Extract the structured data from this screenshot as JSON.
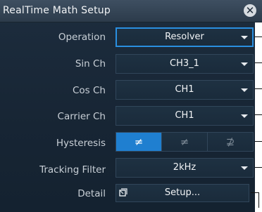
{
  "title": "RealTime Math Setup",
  "close_icon": "close-icon",
  "rows": {
    "operation": {
      "label": "Operation",
      "value": "Resolver"
    },
    "sin_ch": {
      "label": "Sin Ch",
      "value": "CH3_1"
    },
    "cos_ch": {
      "label": "Cos Ch",
      "value": "CH1"
    },
    "carrier_ch": {
      "label": "Carrier Ch",
      "value": "CH1"
    },
    "hysteresis": {
      "label": "Hysteresis",
      "options": [
        "≠",
        "≠",
        "⊉"
      ],
      "selected_index": 0
    },
    "tracking_filter": {
      "label": "Tracking Filter",
      "value": "2kHz"
    },
    "detail": {
      "label": "Detail",
      "button": "Setup...",
      "icon": "setup-icon"
    }
  },
  "colors": {
    "accent": "#1f7fd0",
    "focus_border": "#2a8fe0",
    "background": "#172534"
  }
}
